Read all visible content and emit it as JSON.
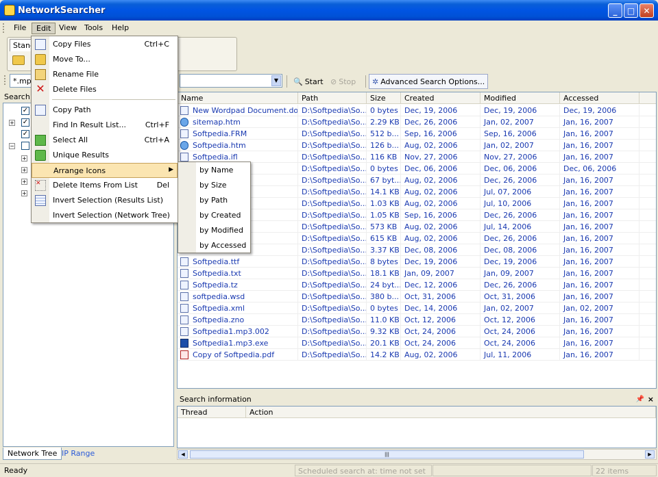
{
  "window": {
    "title": "NetworkSearcher"
  },
  "menubar": {
    "items": [
      "File",
      "Edit",
      "View",
      "Tools",
      "Help"
    ]
  },
  "left": {
    "toolbar_tab": "Stand",
    "search_combo_value": "*.mp",
    "search_label": "Search",
    "bottom_tabs": [
      "Network Tree",
      "IP Range"
    ]
  },
  "toolbar": {
    "start_label": "Start",
    "stop_label": "Stop",
    "advanced_label": "Advanced Search Options..."
  },
  "columns": [
    "Name",
    "Path",
    "Size",
    "Created",
    "Modified",
    "Accessed"
  ],
  "rows": [
    {
      "name": "New Wordpad Document.doc",
      "path": "D:\\Softpedia\\So...",
      "size": "0 bytes",
      "created": "Dec, 19, 2006",
      "modified": "Dec, 19, 2006",
      "accessed": "Dec, 19, 2006",
      "icon": "doc"
    },
    {
      "name": "sitemap.htm",
      "path": "D:\\Softpedia\\So...",
      "size": "2.29 KB",
      "created": "Dec, 26, 2006",
      "modified": "Jan, 02, 2007",
      "accessed": "Jan, 16, 2007",
      "icon": "globe"
    },
    {
      "name": "Softpedia.FRM",
      "path": "D:\\Softpedia\\So...",
      "size": "512 b...",
      "created": "Sep, 16, 2006",
      "modified": "Sep, 16, 2006",
      "accessed": "Jan, 16, 2007",
      "icon": "doc"
    },
    {
      "name": "Softpedia.htm",
      "path": "D:\\Softpedia\\So...",
      "size": "126 b...",
      "created": "Aug, 02, 2006",
      "modified": "Jan, 02, 2007",
      "accessed": "Jan, 16, 2007",
      "icon": "globe"
    },
    {
      "name": "Softpedia.ifl",
      "path": "D:\\Softpedia\\So...",
      "size": "116 KB",
      "created": "Nov, 27, 2006",
      "modified": "Nov, 27, 2006",
      "accessed": "Jan, 16, 2007",
      "icon": "doc"
    },
    {
      "name": "",
      "path": "D:\\Softpedia\\So...",
      "size": "0 bytes",
      "created": "Dec, 06, 2006",
      "modified": "Dec, 06, 2006",
      "accessed": "Dec, 06, 2006",
      "icon": "none"
    },
    {
      "name": "",
      "path": "D:\\Softpedia\\So...",
      "size": "67 byt...",
      "created": "Aug, 02, 2006",
      "modified": "Dec, 26, 2006",
      "accessed": "Jan, 16, 2007",
      "icon": "none"
    },
    {
      "name": "",
      "path": "D:\\Softpedia\\So...",
      "size": "14.1 KB",
      "created": "Aug, 02, 2006",
      "modified": "Jul, 07, 2006",
      "accessed": "Jan, 16, 2007",
      "icon": "none"
    },
    {
      "name": "",
      "path": "D:\\Softpedia\\So...",
      "size": "1.03 KB",
      "created": "Aug, 02, 2006",
      "modified": "Jul, 10, 2006",
      "accessed": "Jan, 16, 2007",
      "icon": "none"
    },
    {
      "name": "",
      "path": "D:\\Softpedia\\So...",
      "size": "1.05 KB",
      "created": "Sep, 16, 2006",
      "modified": "Dec, 26, 2006",
      "accessed": "Jan, 16, 2007",
      "icon": "none"
    },
    {
      "name": "",
      "path": "D:\\Softpedia\\So...",
      "size": "573 KB",
      "created": "Aug, 02, 2006",
      "modified": "Jul, 14, 2006",
      "accessed": "Jan, 16, 2007",
      "icon": "none"
    },
    {
      "name": "",
      "path": "D:\\Softpedia\\So...",
      "size": "615 KB",
      "created": "Aug, 02, 2006",
      "modified": "Dec, 26, 2006",
      "accessed": "Jan, 16, 2007",
      "icon": "none"
    },
    {
      "name": "",
      "path": "D:\\Softpedia\\So...",
      "size": "3.37 KB",
      "created": "Dec, 08, 2006",
      "modified": "Dec, 08, 2006",
      "accessed": "Jan, 16, 2007",
      "icon": "none"
    },
    {
      "name": "Softpedia.ttf",
      "path": "D:\\Softpedia\\So...",
      "size": "8 bytes",
      "created": "Dec, 19, 2006",
      "modified": "Dec, 19, 2006",
      "accessed": "Jan, 16, 2007",
      "icon": "doc"
    },
    {
      "name": "Softpedia.txt",
      "path": "D:\\Softpedia\\So...",
      "size": "18.1 KB",
      "created": "Jan, 09, 2007",
      "modified": "Jan, 09, 2007",
      "accessed": "Jan, 16, 2007",
      "icon": "doc"
    },
    {
      "name": "Softpedia.tz",
      "path": "D:\\Softpedia\\So...",
      "size": "24 byt...",
      "created": "Dec, 12, 2006",
      "modified": "Dec, 26, 2006",
      "accessed": "Jan, 16, 2007",
      "icon": "doc"
    },
    {
      "name": "softpedia.wsd",
      "path": "D:\\Softpedia\\So...",
      "size": "380 b...",
      "created": "Oct, 31, 2006",
      "modified": "Oct, 31, 2006",
      "accessed": "Jan, 16, 2007",
      "icon": "doc"
    },
    {
      "name": "Softpedia.xml",
      "path": "D:\\Softpedia\\So...",
      "size": "0 bytes",
      "created": "Dec, 14, 2006",
      "modified": "Jan, 02, 2007",
      "accessed": "Jan, 02, 2007",
      "icon": "doc"
    },
    {
      "name": "Softpedia.zno",
      "path": "D:\\Softpedia\\So...",
      "size": "11.0 KB",
      "created": "Oct, 12, 2006",
      "modified": "Oct, 12, 2006",
      "accessed": "Jan, 16, 2007",
      "icon": "doc"
    },
    {
      "name": "Softpedia1.mp3.002",
      "path": "D:\\Softpedia\\So...",
      "size": "9.32 KB",
      "created": "Oct, 24, 2006",
      "modified": "Oct, 24, 2006",
      "accessed": "Jan, 16, 2007",
      "icon": "doc"
    },
    {
      "name": "Softpedia1.mp3.exe",
      "path": "D:\\Softpedia\\So...",
      "size": "20.1 KB",
      "created": "Oct, 24, 2006",
      "modified": "Oct, 24, 2006",
      "accessed": "Jan, 16, 2007",
      "icon": "exe"
    },
    {
      "name": "Copy of Softpedia.pdf",
      "path": "D:\\Softpedia\\So...",
      "size": "14.2 KB",
      "created": "Aug, 02, 2006",
      "modified": "Jul, 11, 2006",
      "accessed": "Jan, 16, 2007",
      "icon": "pdf"
    }
  ],
  "edit_menu": {
    "items": [
      {
        "label": "Copy Files",
        "accel": "Ctrl+C",
        "icon": "copy-files-icon"
      },
      {
        "label": "Move To...",
        "accel": "",
        "icon": "move-to-icon"
      },
      {
        "label": "Rename File",
        "accel": "",
        "icon": "rename-icon"
      },
      {
        "label": "Delete Files",
        "accel": "",
        "icon": "delete-icon"
      },
      {
        "label": "Copy Path",
        "accel": "",
        "icon": "copy-path-icon"
      },
      {
        "label": "Find In Result List...",
        "accel": "Ctrl+F",
        "icon": ""
      },
      {
        "label": "Select All",
        "accel": "Ctrl+A",
        "icon": "select-all-icon"
      },
      {
        "label": "Unique Results",
        "accel": "",
        "icon": "unique-results-icon"
      },
      {
        "label": "Arrange Icons",
        "accel": "",
        "icon": ""
      },
      {
        "label": "Delete Items From List",
        "accel": "Del",
        "icon": "delete-items-icon"
      },
      {
        "label": "Invert Selection (Results List)",
        "accel": "",
        "icon": "invert-selection-icon"
      },
      {
        "label": "Invert Selection (Network Tree)",
        "accel": "",
        "icon": ""
      }
    ]
  },
  "arrange_submenu": {
    "items": [
      "by Name",
      "by Size",
      "by Path",
      "by Created",
      "by Modified",
      "by Accessed"
    ]
  },
  "search_info": {
    "title": "Search information",
    "columns": [
      "Thread",
      "Action"
    ]
  },
  "status": {
    "ready": "Ready",
    "scheduled": "Scheduled search at:  time not set",
    "items": "22 items"
  },
  "colors": {
    "link_blue": "#1838b0",
    "menu_highlight": "#fbe5b1",
    "title_blue": "#0054e3"
  }
}
